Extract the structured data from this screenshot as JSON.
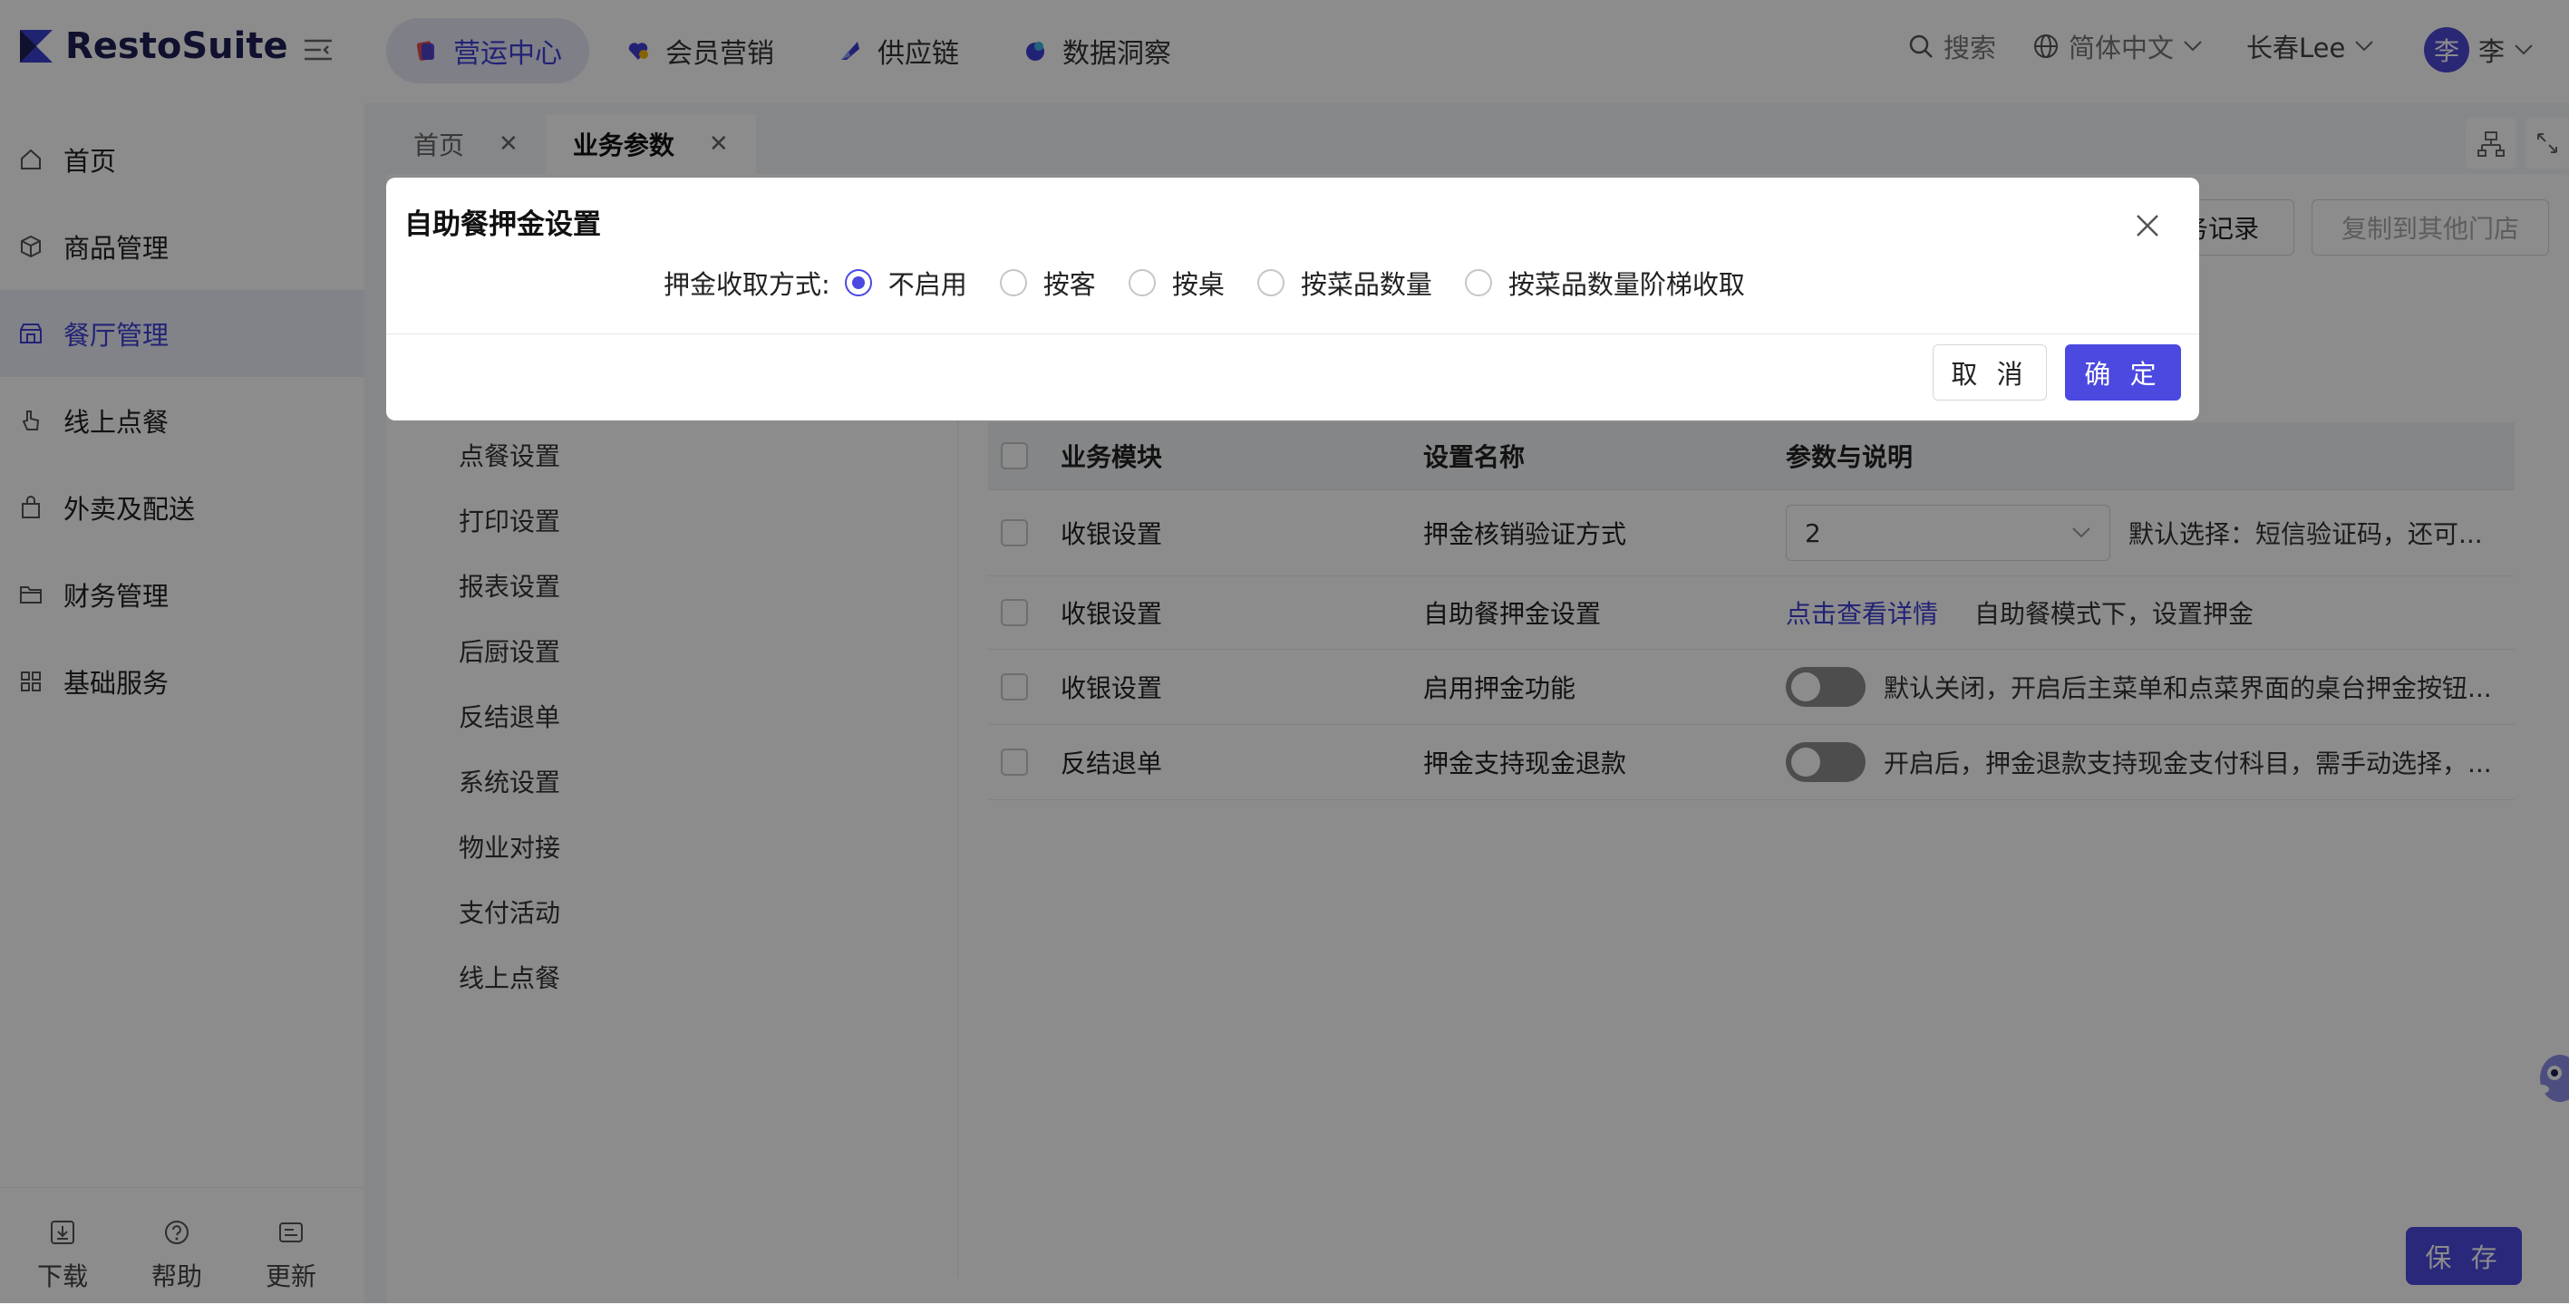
{
  "brand": {
    "name": "RestoSuite"
  },
  "topnav": {
    "items": [
      {
        "label": "营运中心",
        "active": true
      },
      {
        "label": "会员营销",
        "active": false
      },
      {
        "label": "供应链",
        "active": false
      },
      {
        "label": "数据洞察",
        "active": false
      }
    ],
    "search_label": "搜索",
    "language": "简体中文",
    "store": "长春Lee",
    "avatar_char": "李",
    "user_name": "李"
  },
  "sidebar": {
    "items": [
      {
        "label": "首页",
        "icon": "home-icon"
      },
      {
        "label": "商品管理",
        "icon": "box-icon"
      },
      {
        "label": "餐厅管理",
        "icon": "store-icon",
        "active": true
      },
      {
        "label": "线上点餐",
        "icon": "pointer-icon"
      },
      {
        "label": "外卖及配送",
        "icon": "bag-icon"
      },
      {
        "label": "财务管理",
        "icon": "folder-icon"
      },
      {
        "label": "基础服务",
        "icon": "grid-icon"
      }
    ],
    "bottom": [
      {
        "label": "下载",
        "icon": "download-icon"
      },
      {
        "label": "帮助",
        "icon": "help-icon"
      },
      {
        "label": "更新",
        "icon": "update-icon"
      }
    ]
  },
  "tabs": [
    {
      "label": "首页",
      "active": false
    },
    {
      "label": "业务参数",
      "active": true
    }
  ],
  "header_buttons": {
    "records": "务记录",
    "copy": "复制到其他门店"
  },
  "categories": [
    "点餐设置",
    "打印设置",
    "报表设置",
    "后厨设置",
    "反结退单",
    "系统设置",
    "物业对接",
    "支付活动",
    "线上点餐"
  ],
  "table": {
    "columns": [
      "业务模块",
      "设置名称",
      "参数与说明"
    ],
    "rows": [
      {
        "module": "收银设置",
        "name": "押金核销验证方式",
        "type": "select",
        "value": "2",
        "desc": "默认选择：短信验证码，还可..."
      },
      {
        "module": "收银设置",
        "name": "自助餐押金设置",
        "type": "link",
        "value": "点击查看详情",
        "desc": "自助餐模式下，设置押金"
      },
      {
        "module": "收银设置",
        "name": "启用押金功能",
        "type": "switch",
        "value": "off",
        "desc": "默认关闭，开启后主菜单和点菜界面的桌台押金按钮..."
      },
      {
        "module": "反结退单",
        "name": "押金支持现金退款",
        "type": "switch",
        "value": "off",
        "desc": "开启后，押金退款支持现金支付科目，需手动选择，..."
      }
    ]
  },
  "save_label": "保 存",
  "modal": {
    "title": "自助餐押金设置",
    "field_label": "押金收取方式:",
    "options": [
      {
        "label": "不启用",
        "checked": true
      },
      {
        "label": "按客",
        "checked": false
      },
      {
        "label": "按桌",
        "checked": false
      },
      {
        "label": "按菜品数量",
        "checked": false
      },
      {
        "label": "按菜品数量阶梯收取",
        "checked": false
      }
    ],
    "cancel_label": "取 消",
    "ok_label": "确 定"
  },
  "colors": {
    "accent": "#4b49e0",
    "brand_text": "#1d2055"
  }
}
